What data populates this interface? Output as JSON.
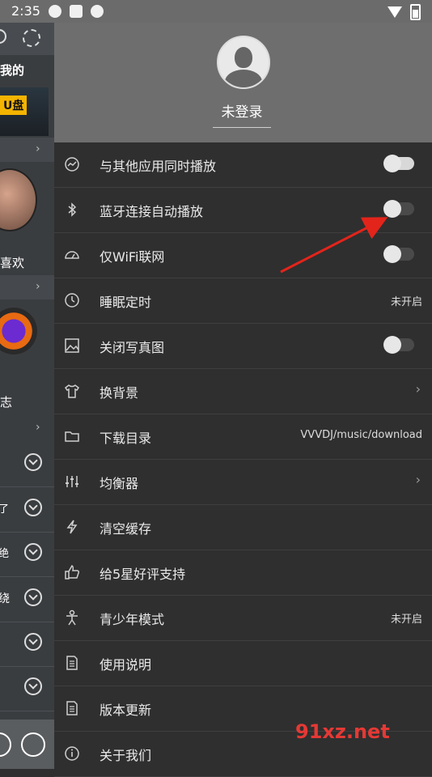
{
  "status_bar": {
    "time": "2:35"
  },
  "left_panel": {
    "mine_label": "我的",
    "u_disk_label": "U盘",
    "like_label": "喜欢",
    "zhi_label": "志",
    "side_labels": [
      "了",
      "绝",
      "绕"
    ]
  },
  "profile": {
    "login_text": "未登录"
  },
  "menu": [
    {
      "label": "与其他应用同时播放",
      "icon": "trend-icon",
      "kind": "toggle"
    },
    {
      "label": "蓝牙连接自动播放",
      "icon": "bluetooth-icon",
      "kind": "toggle"
    },
    {
      "label": "仅WiFi联网",
      "icon": "speedometer-icon",
      "kind": "toggle"
    },
    {
      "label": "睡眠定时",
      "icon": "timer-icon",
      "kind": "value",
      "value": "未开启"
    },
    {
      "label": "关闭写真图",
      "icon": "picture-icon",
      "kind": "toggle"
    },
    {
      "label": "换背景",
      "icon": "shirt-icon",
      "kind": "arrow"
    },
    {
      "label": "下载目录",
      "icon": "folder-icon",
      "kind": "value",
      "value": "VVVDJ/music/download"
    },
    {
      "label": "均衡器",
      "icon": "equalizer-icon",
      "kind": "arrow"
    },
    {
      "label": "清空缓存",
      "icon": "lightning-icon",
      "kind": "none"
    },
    {
      "label": "给5星好评支持",
      "icon": "thumbs-up-icon",
      "kind": "none"
    },
    {
      "label": "青少年模式",
      "icon": "person-icon",
      "kind": "value",
      "value": "未开启"
    },
    {
      "label": "使用说明",
      "icon": "document-icon",
      "kind": "none"
    },
    {
      "label": "版本更新",
      "icon": "document-icon",
      "kind": "none"
    },
    {
      "label": "关于我们",
      "icon": "info-icon",
      "kind": "none"
    }
  ],
  "watermark": "91xz.net",
  "colors": {
    "drawer_bg": "#2f2f2f",
    "header_bg": "#6e6e6e",
    "annotation": "#e3241b"
  }
}
